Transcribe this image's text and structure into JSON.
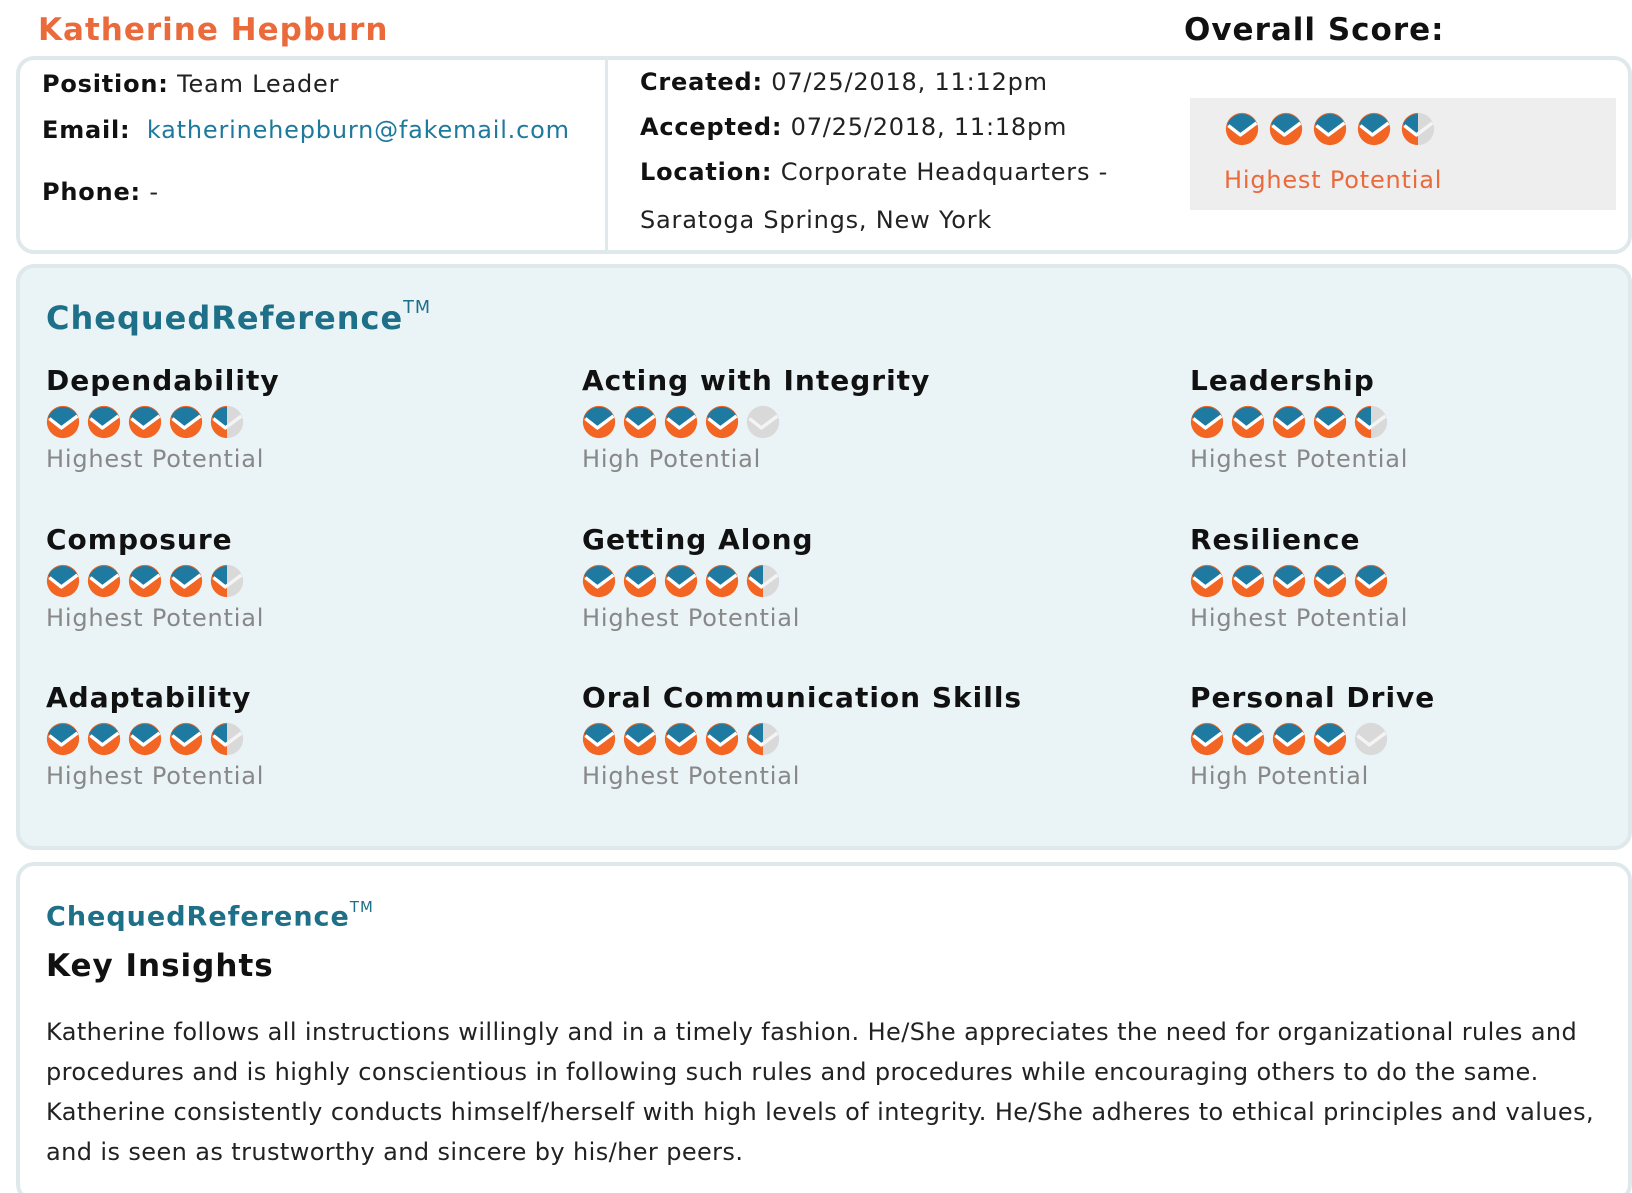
{
  "candidate": {
    "name": "Katherine Hepburn"
  },
  "overall": {
    "label": "Overall Score:",
    "score": 4.5,
    "rating": "Highest Potential"
  },
  "info": {
    "position_label": "Position:",
    "position": "Team Leader",
    "email_label": "Email:",
    "email": "katherinehepburn@fakemail.com",
    "phone_label": "Phone:",
    "phone": "-",
    "created_label": "Created:",
    "created": "07/25/2018, 11:12pm",
    "accepted_label": "Accepted:",
    "accepted": "07/25/2018, 11:18pm",
    "location_label": "Location:",
    "location_line1": "Corporate Headquarters -",
    "location_line2": "Saratoga Springs, New York"
  },
  "brand": {
    "name": "ChequedReference",
    "tm": "TM"
  },
  "metrics": [
    {
      "title": "Dependability",
      "score": 4.5,
      "rating": "Highest Potential"
    },
    {
      "title": "Acting with Integrity",
      "score": 4,
      "rating": "High Potential"
    },
    {
      "title": "Leadership",
      "score": 4.5,
      "rating": "Highest Potential"
    },
    {
      "title": "Composure",
      "score": 4.5,
      "rating": "Highest Potential"
    },
    {
      "title": "Getting Along",
      "score": 4.5,
      "rating": "Highest Potential"
    },
    {
      "title": "Resilience",
      "score": 5,
      "rating": "Highest Potential"
    },
    {
      "title": "Adaptability",
      "score": 4.5,
      "rating": "Highest Potential"
    },
    {
      "title": "Oral Communication Skills",
      "score": 4.5,
      "rating": "Highest Potential"
    },
    {
      "title": "Personal Drive",
      "score": 4,
      "rating": "High Potential"
    }
  ],
  "insights": {
    "title": "Key Insights",
    "text": "Katherine follows all instructions willingly and in a timely fashion. He/She appreciates the need for organizational rules and procedures and is highly conscientious in following such rules and procedures while encouraging others to do the same. Katherine consistently conducts himself/herself with high levels of integrity. He/She adheres to ethical principles and values, and is seen as trustworthy and sincere by his/her peers."
  },
  "colors": {
    "accent_orange": "#f26522",
    "accent_blue": "#1e7aa0",
    "inactive_gray": "#d9d9d9",
    "name_orange": "#ea6a3c"
  }
}
